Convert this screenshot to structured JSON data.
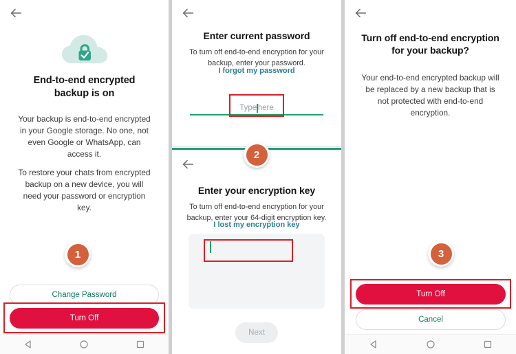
{
  "panel1": {
    "back_label": "back-arrow",
    "icon": "cloud-lock-icon",
    "title": "End-to-end encrypted backup is on",
    "body1": "Your backup is end-to-end encrypted in your Google storage. No one, not even Google or WhatsApp, can access it.",
    "body2": "To restore your chats from encrypted backup on a new device, you will need your password or encryption key.",
    "step_number": "1",
    "change_password_label": "Change Password",
    "turn_off_label": "Turn Off"
  },
  "panel2": {
    "top": {
      "back_label": "back-arrow",
      "title": "Enter current password",
      "body": "To turn off end-to-end encryption for your backup, enter your password.",
      "link": "I forgot my password",
      "input_placeholder": "Type here",
      "input_value": ""
    },
    "bottom": {
      "back_label": "back-arrow",
      "step_number": "2",
      "title": "Enter your encryption key",
      "body": "To turn off end-to-end encryption for your backup, enter your 64-digit encryption key.",
      "link": "I lost my encryption key",
      "input_value": "",
      "next_label": "Next"
    }
  },
  "panel3": {
    "back_label": "back-arrow",
    "title": "Turn off end-to-end encryption for your backup?",
    "body": "Your end-to-end encrypted backup will be replaced by a new backup that is not protected with end-to-end encryption.",
    "step_number": "3",
    "turn_off_label": "Turn Off",
    "cancel_label": "Cancel"
  },
  "navbar": {
    "back_icon": "triangle-back-icon",
    "home_icon": "circle-home-icon",
    "recents_icon": "square-recents-icon"
  },
  "colors": {
    "primary_red": "#e0113e",
    "annotation_red": "#d62027",
    "badge_orange": "#d4603c",
    "link_teal": "#2b7f91",
    "green": "#1f9e79",
    "cloud": "#d3e9e3",
    "lock": "#2fa58c"
  }
}
